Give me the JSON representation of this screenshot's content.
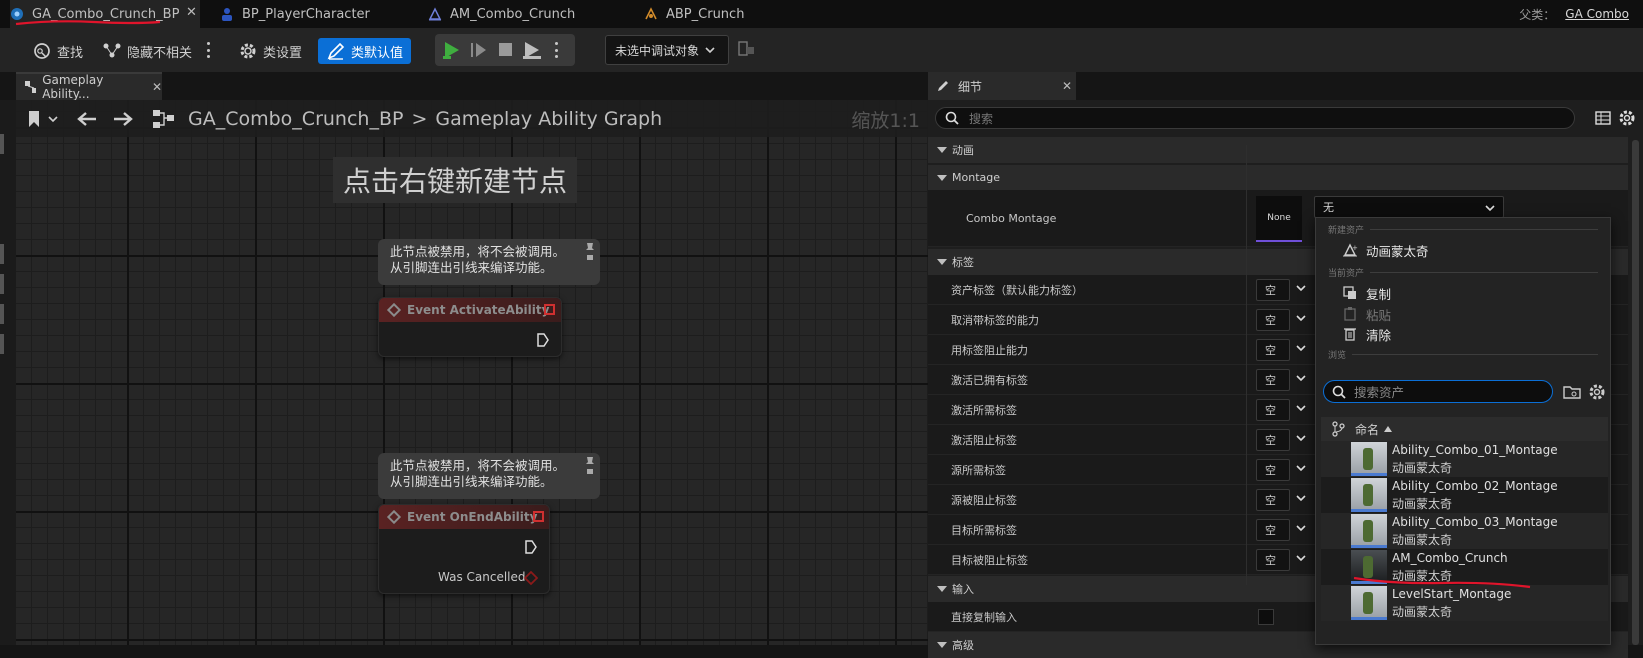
{
  "tabs": [
    {
      "label": "GA_Combo_Crunch_BP"
    },
    {
      "label": "BP_PlayerCharacter"
    },
    {
      "label": "AM_Combo_Crunch"
    },
    {
      "label": "ABP_Crunch"
    }
  ],
  "parent_class": {
    "label": "父类：",
    "value": "GA Combo"
  },
  "toolbar": {
    "find": "查找",
    "hide_unrelated": "隐藏不相关",
    "class_settings": "类设置",
    "class_defaults": "类默认值",
    "debug_object": "未选中调试对象"
  },
  "graph": {
    "tab_label": "Gameplay Ability...",
    "breadcrumb_root": "GA_Combo_Crunch_BP",
    "breadcrumb_sep": ">",
    "breadcrumb_graph": "Gameplay Ability Graph",
    "zoom": "缩放1:1",
    "hint": "点击右键新建节点",
    "disabled_note_line1": "此节点被禁用，将不会被调用。",
    "disabled_note_line2": "从引脚连出引线来编译功能。",
    "node1_title": "Event ActivateAbility",
    "node2_title": "Event OnEndAbility",
    "node2_pin": "Was Cancelled"
  },
  "details": {
    "tab_label": "细节",
    "search_placeholder": "搜索",
    "cat_animation": "动画",
    "cat_montage": "Montage",
    "combo_montage_label": "Combo Montage",
    "combo_montage_thumb": "None",
    "combo_montage_value": "无",
    "cat_tags": "标签",
    "tag_rows": [
      {
        "label": "资产标签（默认能力标签）",
        "value": "空"
      },
      {
        "label": "取消带标签的能力",
        "value": "空"
      },
      {
        "label": "用标签阻止能力",
        "value": "空"
      },
      {
        "label": "激活已拥有标签",
        "value": "空"
      },
      {
        "label": "激活所需标签",
        "value": "空"
      },
      {
        "label": "激活阻止标签",
        "value": "空"
      },
      {
        "label": "源所需标签",
        "value": "空"
      },
      {
        "label": "源被阻止标签",
        "value": "空"
      },
      {
        "label": "目标所需标签",
        "value": "空"
      },
      {
        "label": "目标被阻止标签",
        "value": "空"
      }
    ],
    "cat_input": "输入",
    "direct_input_label": "直接复制输入",
    "cat_advanced": "高级"
  },
  "picker": {
    "sec_new": "新建资产",
    "new_montage": "动画蒙太奇",
    "sec_current": "当前资产",
    "copy": "复制",
    "paste": "粘贴",
    "clear": "清除",
    "sec_browse": "浏览",
    "search_placeholder": "搜索资产",
    "col_name": "命名",
    "assets": [
      {
        "name": "Ability_Combo_01_Montage",
        "type": "动画蒙太奇"
      },
      {
        "name": "Ability_Combo_02_Montage",
        "type": "动画蒙太奇"
      },
      {
        "name": "Ability_Combo_03_Montage",
        "type": "动画蒙太奇"
      },
      {
        "name": "AM_Combo_Crunch",
        "type": "动画蒙太奇"
      },
      {
        "name": "LevelStart_Montage",
        "type": "动画蒙太奇"
      }
    ]
  },
  "colors": {
    "accent": "#0b6fd6",
    "annotation": "#e0142b",
    "play": "#3fae3f"
  }
}
